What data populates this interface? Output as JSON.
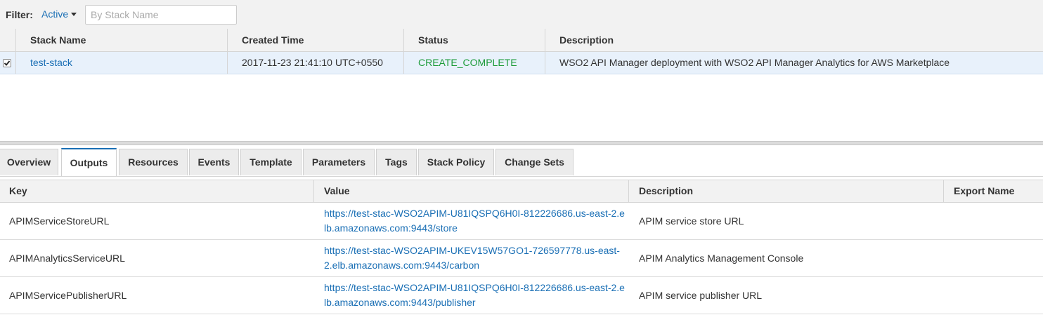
{
  "filter": {
    "label": "Filter:",
    "dropdown_value": "Active",
    "search_placeholder": "By Stack Name"
  },
  "stacks": {
    "headers": [
      "Stack Name",
      "Created Time",
      "Status",
      "Description"
    ],
    "rows": [
      {
        "selected": true,
        "name": "test-stack",
        "created": "2017-11-23 21:41:10 UTC+0550",
        "status": "CREATE_COMPLETE",
        "description": "WSO2 API Manager deployment with WSO2 API Manager Analytics for AWS Marketplace"
      }
    ]
  },
  "tabs": [
    "Overview",
    "Outputs",
    "Resources",
    "Events",
    "Template",
    "Parameters",
    "Tags",
    "Stack Policy",
    "Change Sets"
  ],
  "active_tab": "Outputs",
  "outputs": {
    "headers": [
      "Key",
      "Value",
      "Description",
      "Export Name"
    ],
    "rows": [
      {
        "key": "APIMServiceStoreURL",
        "value": "https://test-stac-WSO2APIM-U81IQSPQ6H0I-812226686.us-east-2.elb.amazonaws.com:9443/store",
        "description": "APIM service store URL",
        "export": ""
      },
      {
        "key": "APIMAnalyticsServiceURL",
        "value": "https://test-stac-WSO2APIM-UKEV15W57GO1-726597778.us-east-2.elb.amazonaws.com:9443/carbon",
        "description": "APIM Analytics Management Console",
        "export": ""
      },
      {
        "key": "APIMServicePublisherURL",
        "value": "https://test-stac-WSO2APIM-U81IQSPQ6H0I-812226686.us-east-2.elb.amazonaws.com:9443/publisher",
        "description": "APIM service publisher URL",
        "export": ""
      }
    ]
  },
  "colors": {
    "link": "#1a6fb5",
    "status_complete": "#1d9b3a",
    "selected_row": "#e8f1fb",
    "header_bg": "#f2f2f2"
  }
}
